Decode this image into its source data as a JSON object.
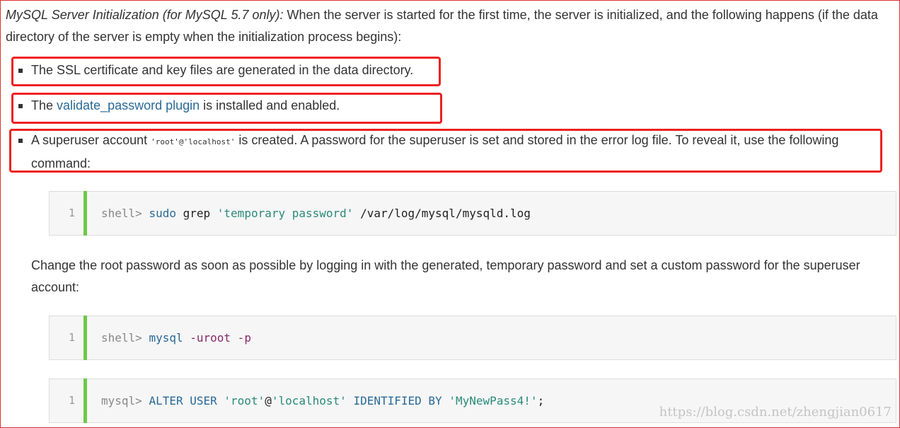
{
  "intro": {
    "lead": "MySQL Server Initialization (for MySQL 5.7 only):",
    "text": " When the server is started for the first time, the server is initialized, and the following happens (if the data directory of the server is empty when the initialization process begins):"
  },
  "bullets": {
    "ssl": "The SSL certificate and key files are generated in the data directory.",
    "validate_pre": "The ",
    "validate_link": "validate_password plugin",
    "validate_post": " is installed and enabled.",
    "superuser_pre": "A superuser account ",
    "superuser_code": "'root'@'localhost'",
    "superuser_post": " is created. A password for the superuser is set and stored in the error log file. To reveal it, use the following command:"
  },
  "code1": {
    "line_number": "1",
    "prompt": "shell>",
    "cmd": "sudo",
    "arg1": "grep",
    "str": "'temporary password'",
    "path": "/var/log/mysql/mysqld.log"
  },
  "paragraph": "Change the root password as soon as possible by logging in with the generated, temporary password and set a custom password for the superuser account:",
  "code2": {
    "line_number": "1",
    "prompt": "shell>",
    "cmd": "mysql",
    "flags": "-uroot -p"
  },
  "code3": {
    "line_number": "1",
    "prompt": "mysql>",
    "kw1": "ALTER USER",
    "str1": "'root'",
    "at": "@",
    "str2": "'localhost'",
    "kw2": "IDENTIFIED BY",
    "str3": "'MyNewPass4!'",
    "end": ";"
  },
  "watermark": "https://blog.csdn.net/zhengjian0617",
  "colors": {
    "highlight_box": "#ee2020",
    "link": "#2a6a96",
    "code_bar": "#6ec84a"
  }
}
